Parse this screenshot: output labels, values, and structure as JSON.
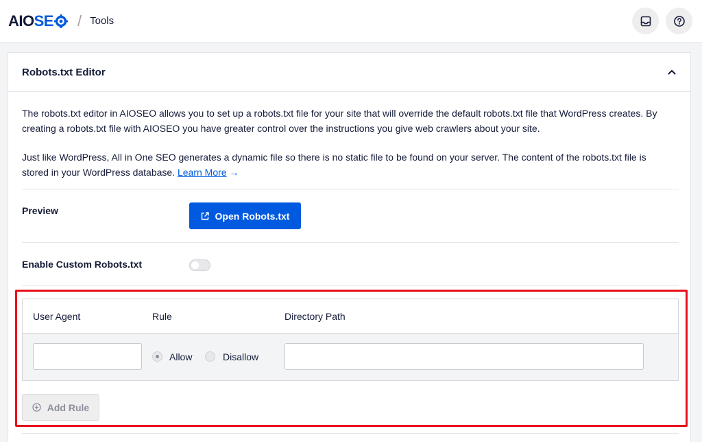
{
  "header": {
    "logo_aio": "AIO",
    "logo_seo": "SE",
    "separator": "/",
    "breadcrumb_page": "Tools"
  },
  "panel": {
    "title": "Robots.txt Editor",
    "desc1": "The robots.txt editor in AIOSEO allows you to set up a robots.txt file for your site that will override the default robots.txt file that WordPress creates. By creating a robots.txt file with AIOSEO you have greater control over the instructions you give web crawlers about your site.",
    "desc2": "Just like WordPress, All in One SEO generates a dynamic file so there is no static file to be found on your server. The content of the robots.txt file is stored in your WordPress database.",
    "learn_more": "Learn More",
    "learn_more_arrow": "→"
  },
  "preview": {
    "label": "Preview",
    "button_label": "Open Robots.txt"
  },
  "custom_robots": {
    "label": "Enable Custom Robots.txt",
    "enabled": false
  },
  "rules_table": {
    "headers": [
      "User Agent",
      "Rule",
      "Directory Path"
    ],
    "row": {
      "user_agent_value": "",
      "rule_allow_label": "Allow",
      "rule_disallow_label": "Disallow",
      "selected_rule": "Allow",
      "directory_path_value": ""
    }
  },
  "add_rule": {
    "label": "Add Rule"
  },
  "colors": {
    "brand_blue": "#005ae0",
    "highlight_red": "#e8101c"
  }
}
